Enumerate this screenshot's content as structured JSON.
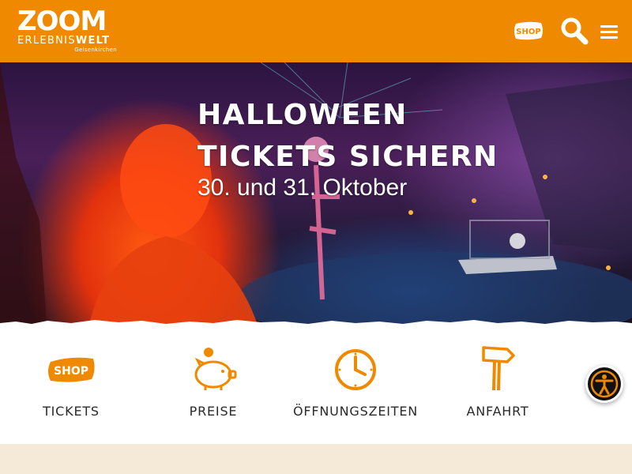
{
  "header": {
    "logo": {
      "line1": "ZOOM",
      "line2_light": "ERLEBNIS",
      "line2_bold": "WELT",
      "city": "Gelsenkirchen"
    },
    "shop_label": "SHOP",
    "search_icon": "search-icon",
    "menu_icon": "hamburger-menu-icon"
  },
  "hero": {
    "title": "HALLOWEEN TICKETS SICHERN",
    "subtitle": "30. und 31. Oktober"
  },
  "quicknav": {
    "items": [
      {
        "label": "TICKETS",
        "icon": "shop-tag-icon",
        "icon_text": "SHOP"
      },
      {
        "label": "PREISE",
        "icon": "piggy-bank-icon"
      },
      {
        "label": "ÖFFNUNGSZEITEN",
        "icon": "clock-icon"
      },
      {
        "label": "ANFAHRT",
        "icon": "signpost-icon"
      }
    ]
  },
  "accessibility": {
    "icon": "accessibility-icon"
  },
  "colors": {
    "brand_orange": "#ef8a00",
    "text_dark": "#2a2a2a",
    "background_beige": "#f3e6d3"
  }
}
